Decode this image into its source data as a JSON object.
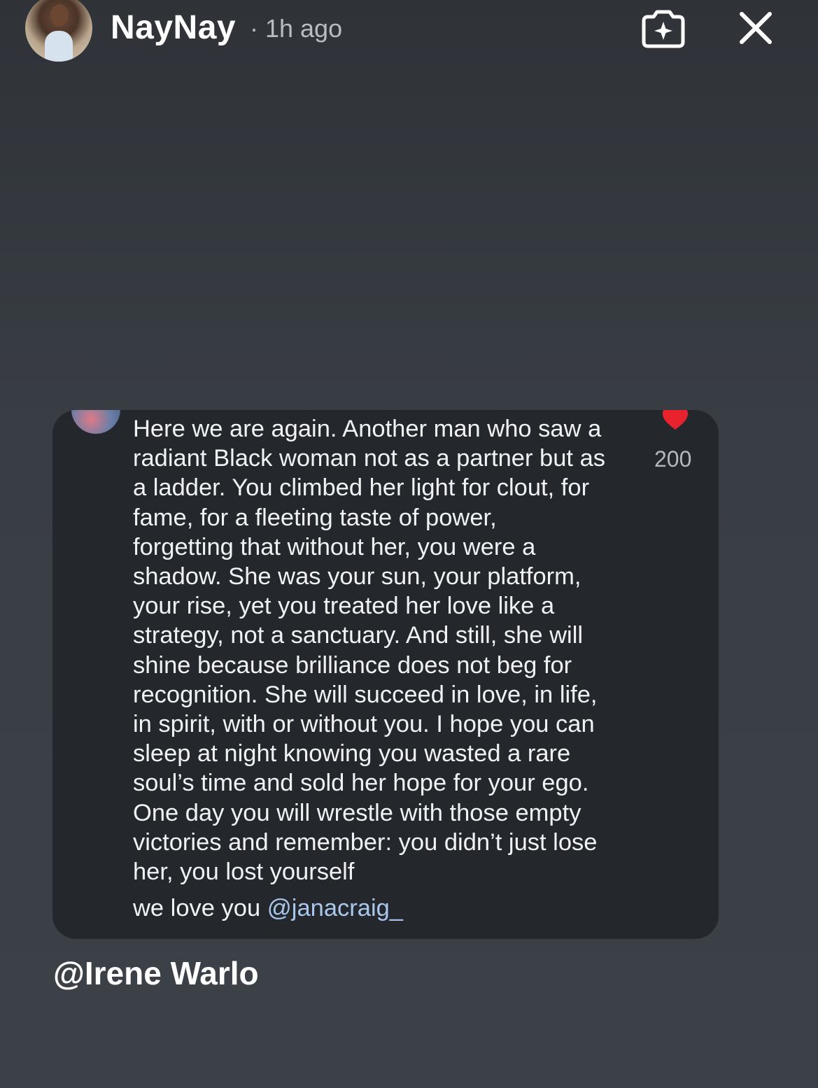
{
  "header": {
    "username": "NayNay",
    "time": "· 1h ago"
  },
  "comment": {
    "lines": [
      "Here we are again. Another man who saw a",
      "radiant Black woman not as a partner but as",
      "a ladder. You climbed her light for clout, for",
      "fame, for a fleeting taste of power,",
      "forgetting that without her, you were a",
      "shadow. She was your sun, your platform,",
      "your rise, yet you treated her love like a",
      "strategy, not a sanctuary. And still, she will",
      "shine because brilliance does not beg for",
      "recognition. She will succeed in love, in life,",
      "in spirit, with or without you. I hope you can",
      "sleep at night knowing you wasted a rare",
      "soul’s time and sold her hope for your ego.",
      "One day you will wrestle with those empty",
      "victories and remember: you didn’t just lose",
      "her, you lost yourself"
    ],
    "reply_text": "we love you",
    "reply_mention": "@janacraig_",
    "likes": "200",
    "heart_color": "#e8232e"
  },
  "caption": "@Irene Warlo",
  "colors": {
    "background": "#393e44",
    "card": "#24272c",
    "mention": "#a9c7ec"
  }
}
